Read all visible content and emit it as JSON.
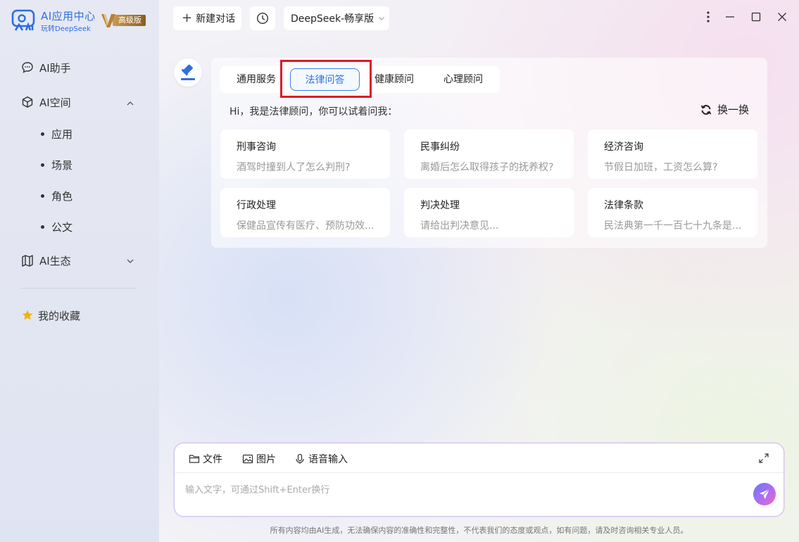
{
  "brand": {
    "title": "AI应用中心",
    "subtitle": "玩转DeepSeek",
    "badge": "高级版",
    "accent": "#2c6fe0"
  },
  "sidebar": {
    "items": [
      {
        "label": "AI助手",
        "icon": "chat-bubble-icon"
      },
      {
        "label": "AI空间",
        "icon": "cube-icon",
        "expanded": true,
        "children": [
          {
            "label": "应用"
          },
          {
            "label": "场景"
          },
          {
            "label": "角色"
          },
          {
            "label": "公文"
          }
        ]
      },
      {
        "label": "AI生态",
        "icon": "book-icon",
        "expanded": false
      }
    ],
    "favorites": {
      "label": "我的收藏",
      "icon": "star-icon"
    }
  },
  "topbar": {
    "new_chat": "新建对话",
    "model": "DeepSeek-畅享版"
  },
  "tabs": [
    {
      "label": "通用服务"
    },
    {
      "label": "法律问答",
      "active": true
    },
    {
      "label": "健康顾问"
    },
    {
      "label": "心理顾问"
    }
  ],
  "greeting": "Hi，我是法律顾问，你可以试着问我：",
  "refresh_label": "换一换",
  "questions": [
    {
      "title": "刑事咨询",
      "text": "酒驾时撞到人了怎么判刑?"
    },
    {
      "title": "民事纠纷",
      "text": "离婚后怎么取得孩子的抚养权?"
    },
    {
      "title": "经济咨询",
      "text": "节假日加班，工资怎么算?"
    },
    {
      "title": "行政处理",
      "text": "保健品宣传有医疗、预防功效..."
    },
    {
      "title": "判决处理",
      "text": "请给出判决意见..."
    },
    {
      "title": "法律条款",
      "text": "民法典第一千一百七十九条是..."
    }
  ],
  "composer": {
    "file": "文件",
    "image": "图片",
    "voice": "语音输入",
    "placeholder": "输入文字，可通过Shift+Enter换行"
  },
  "disclaimer": "所有内容均由AI生成，无法确保内容的准确性和完整性，不代表我们的态度或观点，如有问题，请及时咨询相关专业人员。",
  "colors": {
    "active_tab": "#2a73e8",
    "highlight": "#e0172a",
    "star": "#f5b400"
  }
}
